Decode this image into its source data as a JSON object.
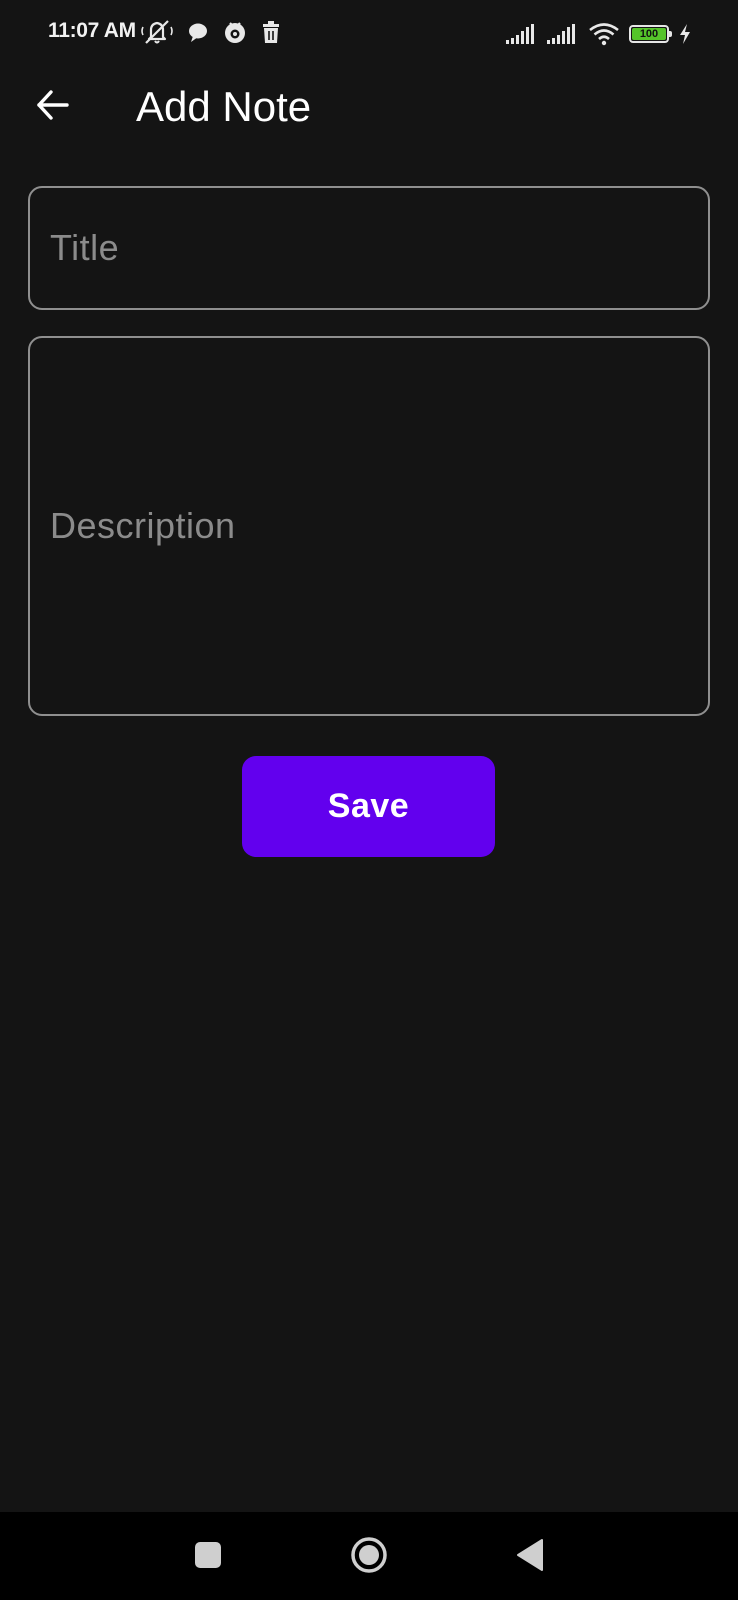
{
  "status_bar": {
    "time": "11:07 AM",
    "battery_level": "100",
    "icons": [
      "mute-icon",
      "chat-bubble-icon",
      "app-notification-icon",
      "trash-icon",
      "signal-icon",
      "signal-icon",
      "wifi-icon",
      "battery-icon",
      "charging-icon"
    ],
    "battery_color": "#55c42a"
  },
  "app_bar": {
    "title": "Add Note",
    "back_icon": "arrow-left-icon"
  },
  "form": {
    "title_field": {
      "value": "",
      "placeholder": "Title"
    },
    "description_field": {
      "value": "",
      "placeholder": "Description"
    },
    "save_label": "Save"
  },
  "nav_bar": {
    "icons": [
      "recents-square-icon",
      "home-circle-icon",
      "back-triangle-icon"
    ]
  },
  "colors": {
    "background": "#141414",
    "accent": "#6200ee",
    "field_border": "#8f8f8f",
    "placeholder": "#8b8b8b",
    "nav_background": "#000000"
  }
}
